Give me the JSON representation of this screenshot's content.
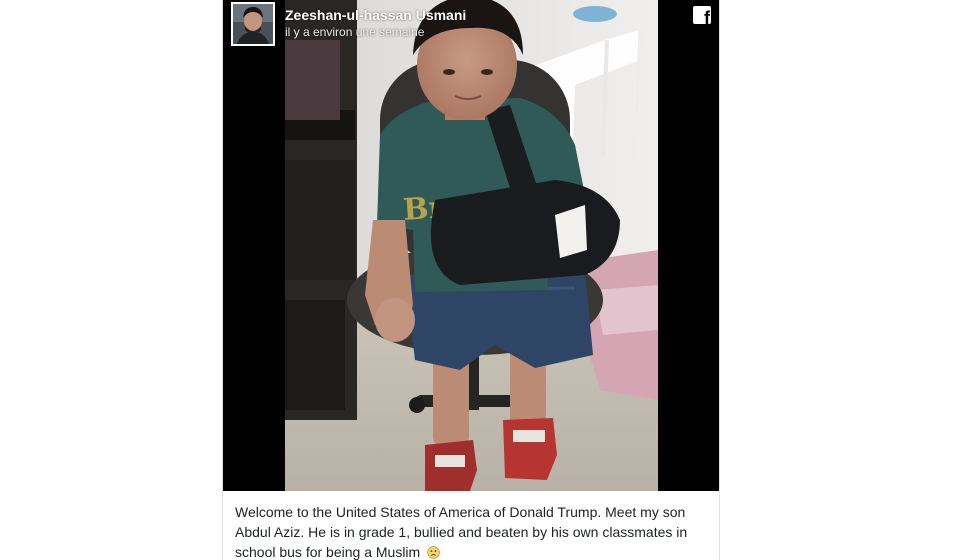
{
  "post": {
    "author_name": "Zeeshan-ul-hassan Usmani",
    "timestamp": "il y a environ une semaine",
    "caption": "Welcome to the United States of America of Donald Trump. Meet my son Abdul Aziz. He is in grade 1, bullied and beaten by his own classmates in school bus for being a Muslim",
    "caption_emoji": "frown-emoji",
    "shirt_text": "Brooklyn"
  },
  "icons": {
    "platform": "facebook-icon",
    "avatar": "profile-photo"
  },
  "colors": {
    "media_background": "#000000",
    "caption_text": "#1d2129",
    "header_text": "#ffffff"
  }
}
